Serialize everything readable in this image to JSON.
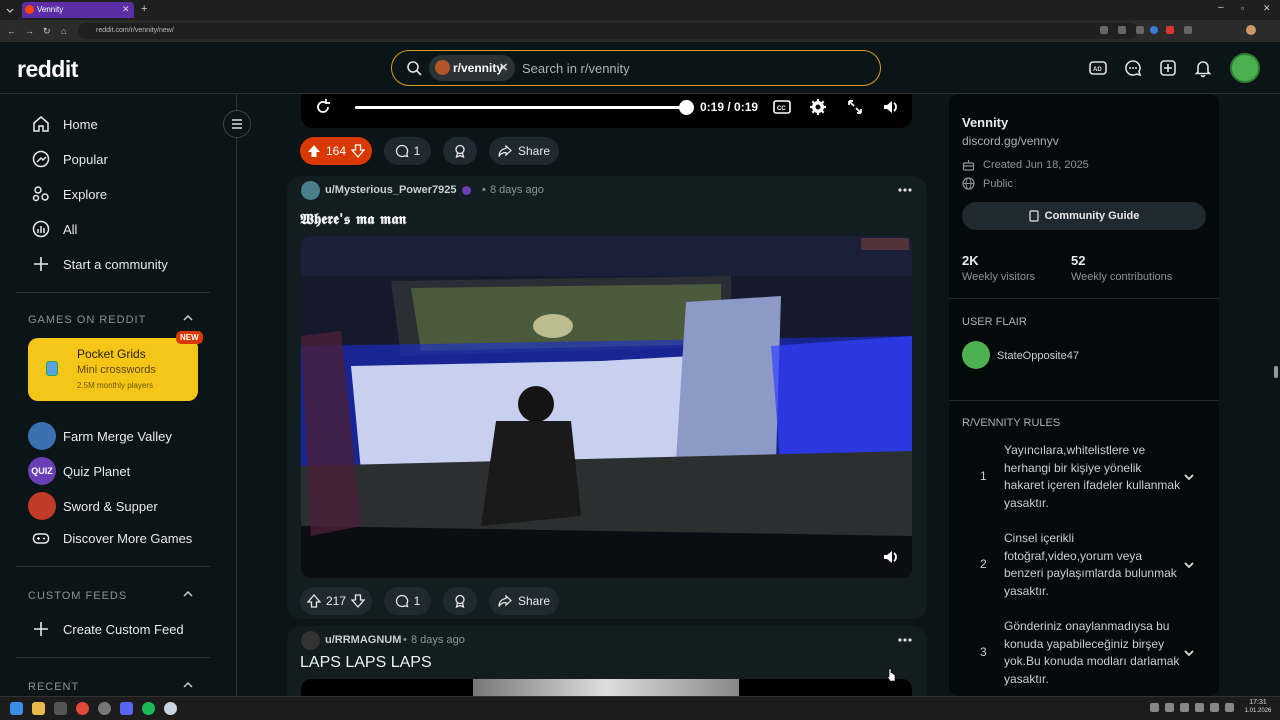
{
  "browser": {
    "tab_title": "Vennity",
    "url": "reddit.com/r/vennity/new/"
  },
  "header": {
    "logo": "reddit",
    "search_chip": "r/vennity",
    "search_placeholder": "Search in r/vennity"
  },
  "nav": {
    "items": [
      "Home",
      "Popular",
      "Explore",
      "All",
      "Start a community"
    ],
    "games_heading": "GAMES ON REDDIT",
    "featured_game": {
      "title": "Pocket Grids",
      "subtitle": "Mini crosswords",
      "players": "2.5M monthly players",
      "badge": "NEW"
    },
    "games": [
      "Farm Merge Valley",
      "Quiz Planet",
      "Sword & Supper",
      "Discover More Games"
    ],
    "quiz_logo_text": "QUIZ",
    "custom_feeds_heading": "CUSTOM FEEDS",
    "create_feed": "Create Custom Feed",
    "recent_heading": "RECENT"
  },
  "video_controls": {
    "time": "0:19 / 0:19",
    "progress": 1.0
  },
  "posts": [
    {
      "score": "164",
      "comments": "1",
      "share": "Share"
    },
    {
      "author": "u/Mysterious_Power7925",
      "time": "8 days ago",
      "title": "𝖂𝖍𝖊𝖗𝖊'𝖘 𝖒𝖆 𝖒𝖆𝖓",
      "score": "217",
      "comments": "1",
      "share": "Share"
    },
    {
      "author": "u/RRMAGNUM",
      "time": "8 days ago",
      "title": "LAPS LAPS LAPS"
    }
  ],
  "sidebar": {
    "name": "Vennity",
    "link": "discord.gg/vennyv",
    "created": "Created Jun 18, 2025",
    "visibility": "Public",
    "guide_button": "Community Guide",
    "stats": [
      {
        "value": "2K",
        "label": "Weekly visitors"
      },
      {
        "value": "52",
        "label": "Weekly contributions"
      }
    ],
    "flair_heading": "USER FLAIR",
    "flair_user": "StateOpposite47",
    "rules_heading": "R/VENNITY RULES",
    "rules": [
      {
        "num": "1",
        "text": "Yayıncılara,whitelistlere ve herhangi bir kişiye yönelik hakaret içeren ifadeler kullanmak yasaktır."
      },
      {
        "num": "2",
        "text": "Cinsel içerikli fotoğraf,video,yorum veya benzeri paylaşımlarda bulunmak yasaktır."
      },
      {
        "num": "3",
        "text": "Gönderiniz onaylanmadıysa bu konuda yapabileceğiniz birşey yok.Bu konuda modları darlamak yasaktır."
      }
    ]
  },
  "taskbar": {
    "time": "17:31",
    "date": "1.01.2026"
  },
  "colors": {
    "background": "#0b1416",
    "card": "#121d21",
    "upvote_active": "#d93900",
    "search_border": "#d4a017",
    "featured_game": "#f5c518"
  }
}
